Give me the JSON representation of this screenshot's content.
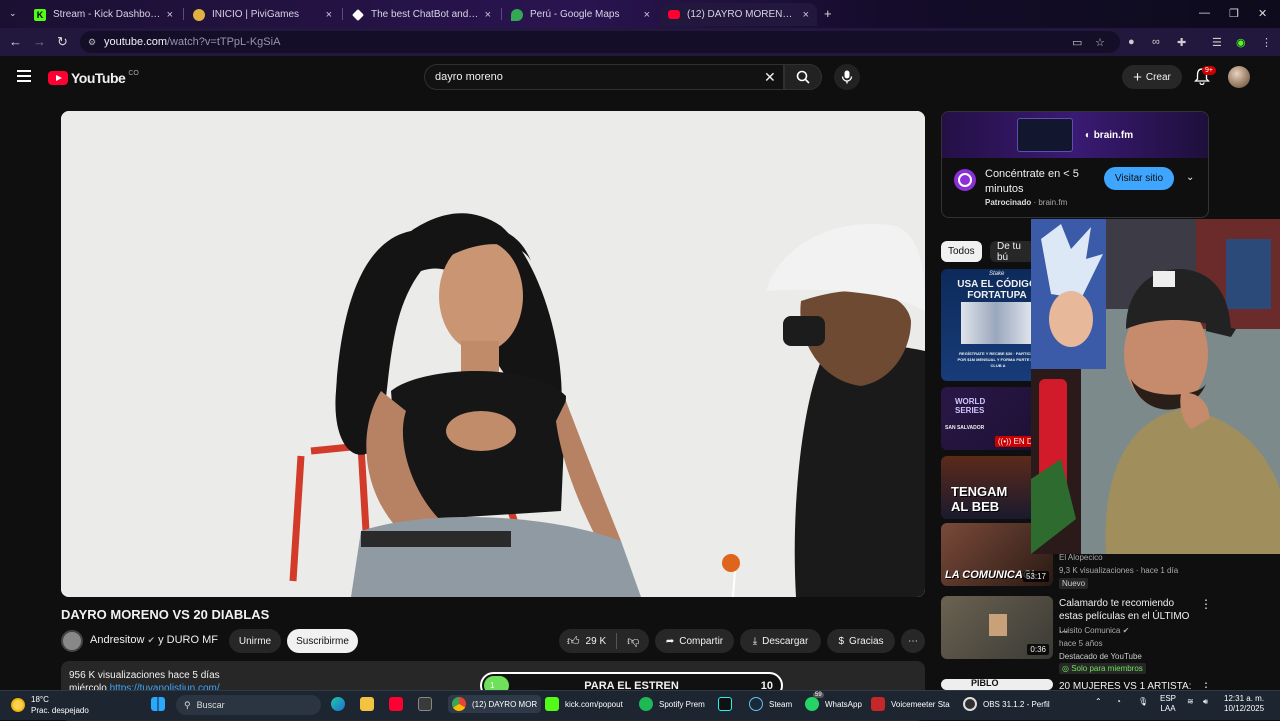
{
  "browser": {
    "tabs": [
      {
        "title": "Stream - Kick Dashboard -",
        "icon": "kick-icon",
        "color": "#53fc18"
      },
      {
        "title": "INICIO | PiviGames",
        "icon": "pivigames-icon",
        "color": "#e0b040"
      },
      {
        "title": "The best ChatBot and Widgets",
        "icon": "streamelements-icon",
        "color": "#ffffff"
      },
      {
        "title": "Perú - Google Maps",
        "icon": "maps-icon",
        "color": "#34a853"
      },
      {
        "title": "(12) DAYRO MORENO VS 20 DIA",
        "icon": "youtube-icon",
        "color": "#ff0033"
      }
    ],
    "url_host": "youtube.com",
    "url_path": "/watch?v=tTPpL-KgSiA"
  },
  "youtube": {
    "logo_text": "YouTube",
    "country": "CO",
    "search_value": "dayro moreno",
    "create_label": "Crear",
    "notif_badge": "9+"
  },
  "video": {
    "title": "DAYRO MORENO VS 20 DIABLAS",
    "channel": "Andresitow",
    "channel_extra": "y DURO MF",
    "join_label": "Unirme",
    "subscribe_label": "Suscribirme",
    "likes": "29 K",
    "share_label": "Compartir",
    "download_label": "Descargar",
    "thanks_label": "Gracias",
    "views_line": "956 K visualizaciones  hace 5 días",
    "desc_partial": "miércolo",
    "desc_link": "https://tuvanolistiun.com/"
  },
  "ad": {
    "brand": "brain.fm",
    "headline": "Concéntrate en < 5 minutos",
    "sponsored": "Patrocinado",
    "domain": "brain.fm",
    "cta": "Visitar sitio"
  },
  "chips": [
    "Todos",
    "De tu bú"
  ],
  "related": [
    {
      "thumb_text": "USA EL CÓDIGO FORTATUPA",
      "thumb_sub": "REGÍSTRATE Y RECIBE $30 · PARTICIPA POR $1M MENSUAL Y FORMA PARTE DEL CLUB A",
      "brand": "Stake"
    },
    {
      "thumb_text": "WORLD SERIES",
      "thumb_sub": "SAN SALVADOR",
      "live": "EN DIRE"
    },
    {
      "thumb_text": "TENGAM AL BEB"
    },
    {
      "thumb_text": "LA COMUNICACI",
      "duration": "53:17",
      "channel": "El Alopecico",
      "meta": "9,3 K visualizaciones · hace 1 día",
      "tag": "Nuevo"
    },
    {
      "title": "Calamardo te recomiendo estas películas en el ÚLTIMO ...",
      "channel": "Luisito Comunica",
      "meta": "hace 5 años",
      "tag": "Destacado de YouTube",
      "members": "Solo para miembros",
      "duration": "0:36"
    },
    {
      "title": "20 MUJERES VS 1 ARTISTA:",
      "thumb_text": "PIBLO"
    }
  ],
  "overlay": {
    "goal_label": "PARA EL ESTREN",
    "goal_count": "10",
    "goal_progress": "1",
    "goal_fill_fraction": 0.1
  },
  "taskbar": {
    "weather_temp": "18°C",
    "weather_desc": "Prac. despejado",
    "search_placeholder": "Buscar",
    "apps": [
      {
        "label": "(12) DAYRO MOR",
        "icon": "chrome-icon",
        "color": "#4285f4"
      },
      {
        "label": "kick.com/popout",
        "icon": "kick-icon",
        "color": "#53fc18"
      },
      {
        "label": "Spotify Prem",
        "icon": "spotify-icon",
        "color": "#1db954"
      },
      {
        "label": "Steam",
        "icon": "steam-icon",
        "color": "#66c0f4"
      },
      {
        "label": "WhatsApp",
        "icon": "whatsapp-icon",
        "color": "#25d366",
        "badge": "59"
      },
      {
        "label": "Voicemeeter Sta",
        "icon": "voicemeeter-icon",
        "color": "#c62828"
      },
      {
        "label": "OBS 31.1.2 - Perfil",
        "icon": "obs-icon",
        "color": "#302e31"
      }
    ],
    "lang": "ESP",
    "lang2": "LAA",
    "time": "12:31 a. m.",
    "date": "10/12/2025"
  }
}
